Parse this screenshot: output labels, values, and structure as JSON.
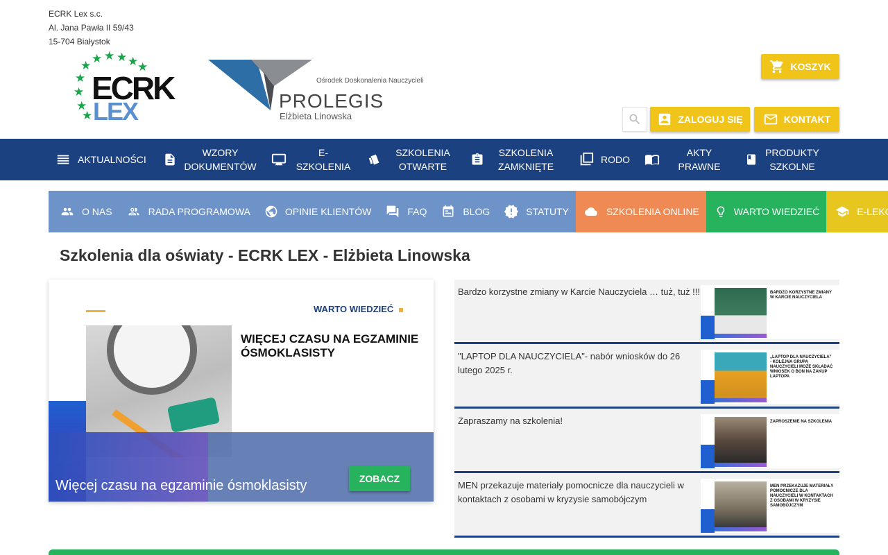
{
  "company": {
    "name": "ECRK Lex s.c.",
    "street": "Al. Jana Pawła II 59/43",
    "city": "15-704 Białystok"
  },
  "logos": {
    "ecrk_line1": "ECRK",
    "ecrk_line2": "LEX",
    "prolegis_subtitle": "Ośrodek Doskonalenia Nauczycieli",
    "prolegis_name": "PROLEGIS",
    "prolegis_person": "Elżbieta Linowska"
  },
  "header_buttons": {
    "cart": "KOSZYK",
    "login": "ZALOGUJ SIĘ",
    "contact": "KONTAKT"
  },
  "main_nav": [
    {
      "icon": "menu-icon",
      "label": "AKTUALNOŚCI"
    },
    {
      "icon": "document-icon",
      "label": "WZORY DOKUMENTÓW"
    },
    {
      "icon": "screen-icon",
      "label": "E-SZKOLENIA"
    },
    {
      "icon": "cards-icon",
      "label": "SZKOLENIA OTWARTE"
    },
    {
      "icon": "clipboard-icon",
      "label": "SZKOLENIA ZAMKNIĘTE"
    },
    {
      "icon": "copy-icon",
      "label": "RODO"
    },
    {
      "icon": "book-icon",
      "label": "AKTY PRAWNE"
    },
    {
      "icon": "product-icon",
      "label": "PRODUKTY SZKOLNE"
    }
  ],
  "sub_nav": [
    {
      "icon": "people-icon",
      "label": "O NAS"
    },
    {
      "icon": "group-icon",
      "label": "RADA PROGRAMOWA"
    },
    {
      "icon": "globe-icon",
      "label": "OPINIE KLIENTÓW"
    },
    {
      "icon": "chat-icon",
      "label": "FAQ"
    },
    {
      "icon": "calendar-icon",
      "label": "BLOG"
    },
    {
      "icon": "badge-icon",
      "label": "STATUTY"
    },
    {
      "icon": "cloud-icon",
      "label": "SZKOLENIA ONLINE",
      "color": "#f08a55"
    },
    {
      "icon": "bulb-icon",
      "label": "WARTO WIEDZIEĆ",
      "color": "#27b35e"
    },
    {
      "icon": "school-icon",
      "label": "E-LEKCJE",
      "color": "#e7c620"
    }
  ],
  "page_title": "Szkolenia dla oświaty - ECRK LEX - Elżbieta Linowska",
  "featured": {
    "tag": "WARTO WIEDZIEĆ",
    "image_title": "WIĘCEJ CZASU NA EGZAMINIE ÓSMOKLASISTY",
    "caption": "Więcej czasu na egzaminie ósmoklasisty",
    "button": "ZOBACZ"
  },
  "news": [
    {
      "title": "Bardzo korzystne zmiany w Karcie Nauczyciela … tuż, tuż !!!",
      "thumb_caption": "BARDZO KORZYSTNE ZMIANY W KARCIE NAUCZYCIELA"
    },
    {
      "title": "\"LAPTOP DLA NAUCZYCIELA\"- nabór wniosków do 26 lutego 2025 r.",
      "thumb_caption": "„LAPTOP DLA NAUCZYCIELA” - KOLEJNA GRUPA NAUCZYCIELI MOŻE SKŁADAĆ WNIOSEK O BON NA ZAKUP LAPTOPA"
    },
    {
      "title": "Zapraszamy na szkolenia!",
      "thumb_caption": "ZAPROSZENIE NA SZKOLENIA"
    },
    {
      "title": "MEN przekazuje materiały pomocnicze dla nauczycieli w kontaktach z osobami w kryzysie samobójczym",
      "thumb_caption": "MEN PRZEKAZUJE MATERIAŁY POMOCNICZE DLA NAUCZYCIELI W KONTAKTACH Z OSOBAMI W KRYZYSIE SAMOBÓJCZYM"
    }
  ],
  "colors": {
    "nav_blue": "#1c4180",
    "subnav_blue": "#6e93c9",
    "yellow": "#f0c419",
    "green": "#27b35e",
    "orange": "#f08a55"
  }
}
